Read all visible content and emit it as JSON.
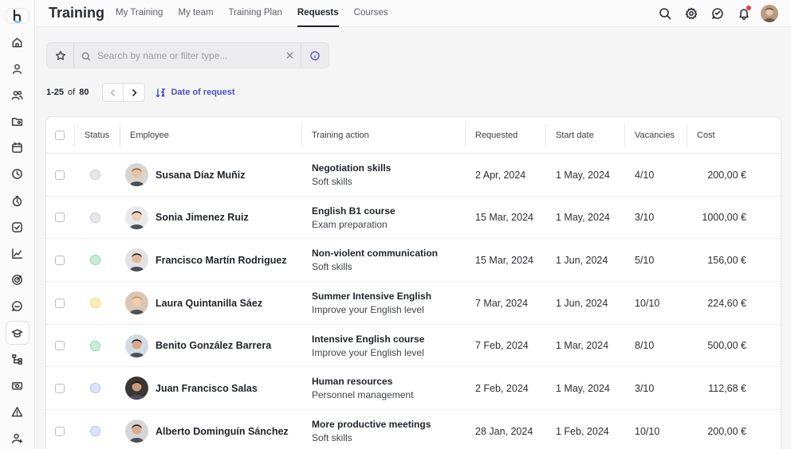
{
  "app": {
    "title": "Training",
    "tabs": [
      {
        "label": "My Training"
      },
      {
        "label": "My team"
      },
      {
        "label": "Training Plan"
      },
      {
        "label": "Requests",
        "active": true
      },
      {
        "label": "Courses"
      }
    ]
  },
  "header_icons": [
    "search-icon",
    "settings-icon",
    "chat-icon",
    "bell-icon",
    "avatar"
  ],
  "sidebar": {
    "items": [
      {
        "icon": "home-icon"
      },
      {
        "icon": "person-icon"
      },
      {
        "icon": "people-icon"
      },
      {
        "icon": "folder-icon"
      },
      {
        "icon": "calendar-icon"
      },
      {
        "icon": "clock-icon"
      },
      {
        "icon": "timer-icon"
      },
      {
        "icon": "checkbox-icon"
      },
      {
        "icon": "chart-icon"
      },
      {
        "icon": "target-icon"
      },
      {
        "icon": "chat-icon"
      },
      {
        "icon": "graduation-cap-icon",
        "active": true
      },
      {
        "icon": "org-chart-icon"
      },
      {
        "icon": "money-icon"
      },
      {
        "icon": "alert-icon"
      },
      {
        "icon": "user-add-icon"
      }
    ]
  },
  "search": {
    "placeholder": "Search by name or filter type..."
  },
  "pagination": {
    "range": "1-25",
    "of": "of",
    "total": "80",
    "sort_label": "Date of request"
  },
  "table": {
    "columns": {
      "status": "Status",
      "employee": "Employee",
      "training_action": "Training action",
      "requested": "Requested",
      "start_date": "Start date",
      "vacancies": "Vacancies",
      "cost": "Cost"
    },
    "rows": [
      {
        "status_color": "#e6e7ea",
        "status_border": "#c9ccd2",
        "name": "Susana Díaz Muñiz",
        "action": "Negotiation skills",
        "category": "Soft skills",
        "requested": "2 Apr, 2024",
        "start": "1 May, 2024",
        "vacancies": "4/10",
        "cost": "200,00 €",
        "avatar_hair": "#8a6a4a",
        "avatar_skin": "#e7c3a3",
        "avatar_bg": "#d8d4cf"
      },
      {
        "status_color": "#e6e7ea",
        "status_border": "#c9ccd2",
        "name": "Sonia Jimenez Ruiz",
        "action": "English B1 course",
        "category": "Exam preparation",
        "requested": "15 Mar, 2024",
        "start": "1 May, 2024",
        "vacancies": "3/10",
        "cost": "1000,00 €",
        "avatar_hair": "#3a2a22",
        "avatar_skin": "#efcfb6",
        "avatar_bg": "#e9e9ea"
      },
      {
        "status_color": "#c8eed8",
        "status_border": "#8fd6ad",
        "name": "Francisco Martín Rodriguez",
        "action": "Non-violent communication",
        "category": "Soft skills",
        "requested": "15 Mar, 2024",
        "start": "1 Jun, 2024",
        "vacancies": "5/10",
        "cost": "156,00 €",
        "avatar_hair": "#2a211c",
        "avatar_skin": "#e3b99a",
        "avatar_bg": "#e2e2e4"
      },
      {
        "status_color": "#fdf0b5",
        "status_border": "#f1d877",
        "name": "Laura Quintanilla Sáez",
        "action": "Summer Intensive English",
        "category": "Improve your English level",
        "requested": "7 Mar, 2024",
        "start": "1 Jun, 2024",
        "vacancies": "10/10",
        "cost": "224,60 €",
        "avatar_hair": "#c99a5e",
        "avatar_skin": "#f0cdb0",
        "avatar_bg": "#d9c7b3"
      },
      {
        "status_color": "#c8eed8",
        "status_border": "#8fd6ad",
        "name": "Benito González Barrera",
        "action": "Intensive English course",
        "category": "Improve your English level",
        "requested": "7 Feb, 2024",
        "start": "1 Mar, 2024",
        "vacancies": "8/10",
        "cost": "500,00 €",
        "avatar_hair": "#1f1a18",
        "avatar_skin": "#d9a887",
        "avatar_bg": "#cfdce6"
      },
      {
        "status_color": "#dfe3fb",
        "status_border": "#b6bff0",
        "name": "Juan Francisco Salas",
        "action": "Human resources",
        "category": "Personnel management",
        "requested": "2 Feb, 2024",
        "start": "1 May, 2024",
        "vacancies": "3/10",
        "cost": "112,68 €",
        "avatar_hair": "#1c1a19",
        "avatar_skin": "#c99a7b",
        "avatar_bg": "#3b3634"
      },
      {
        "status_color": "#dfe3fb",
        "status_border": "#b6bff0",
        "name": "Alberto Dominguín Sánchez",
        "action": "More productive meetings",
        "category": "Soft skills",
        "requested": "28 Jan, 2024",
        "start": "1 Feb, 2024",
        "vacancies": "10/10",
        "cost": "200,00 €",
        "avatar_hair": "#2a2523",
        "avatar_skin": "#d7ad92",
        "avatar_bg": "#d5d5d7"
      }
    ]
  },
  "colors": {
    "accent": "#4a51c9",
    "notification": "#e0413b"
  }
}
